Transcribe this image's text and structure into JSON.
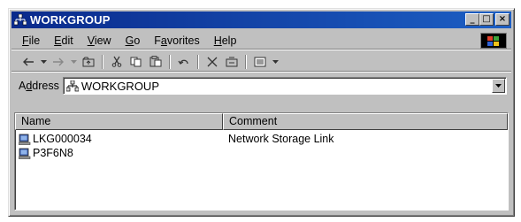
{
  "window": {
    "title": "WORKGROUP",
    "buttons": {
      "minimize": "_",
      "maximize": "□",
      "close": "×"
    }
  },
  "menu": [
    {
      "pre": "",
      "key": "F",
      "post": "ile"
    },
    {
      "pre": "",
      "key": "E",
      "post": "dit"
    },
    {
      "pre": "",
      "key": "V",
      "post": "iew"
    },
    {
      "pre": "",
      "key": "G",
      "post": "o"
    },
    {
      "pre": "F",
      "key": "a",
      "post": "vorites"
    },
    {
      "pre": "",
      "key": "H",
      "post": "elp"
    }
  ],
  "toolbar": {
    "icons": [
      "back-icon",
      "forward-icon",
      "up-folder-icon",
      "cut-icon",
      "copy-icon",
      "paste-icon",
      "undo-icon",
      "delete-icon",
      "properties-icon",
      "views-icon"
    ]
  },
  "address": {
    "label_pre": "A",
    "label_key": "d",
    "label_post": "dress",
    "value": "WORKGROUP"
  },
  "list": {
    "columns": [
      "Name",
      "Comment"
    ],
    "rows": [
      {
        "name": "LKG000034",
        "comment": "Network Storage Link",
        "icon": "computer-icon"
      },
      {
        "name": "P3F6N8",
        "comment": "",
        "icon": "computer-icon"
      }
    ]
  },
  "colors": {
    "titlebar_start": "#0a2a8c",
    "titlebar_end": "#1d5fc4",
    "chrome": "#c0c0c0"
  }
}
